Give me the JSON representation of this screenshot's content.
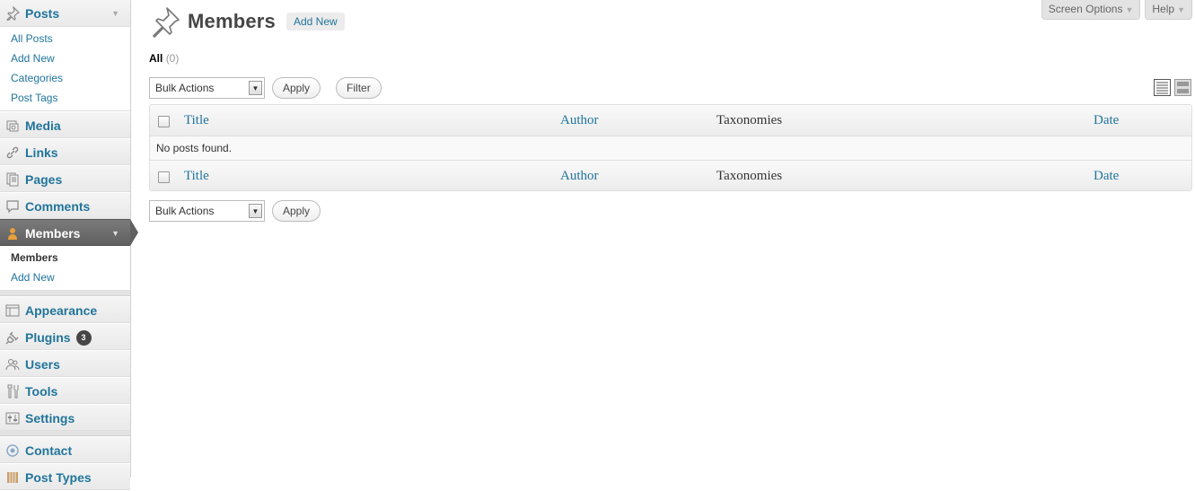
{
  "sidebar": {
    "posts": {
      "label": "Posts",
      "items": [
        "All Posts",
        "Add New",
        "Categories",
        "Post Tags"
      ]
    },
    "media": "Media",
    "links": "Links",
    "pages": "Pages",
    "comments": "Comments",
    "members": {
      "label": "Members",
      "items": [
        "Members",
        "Add New"
      ]
    },
    "appearance": "Appearance",
    "plugins": {
      "label": "Plugins",
      "badge": "3"
    },
    "users": "Users",
    "tools": "Tools",
    "settings": "Settings",
    "contact": "Contact",
    "post_types": "Post Types"
  },
  "screen_meta": {
    "screen_options": "Screen Options",
    "help": "Help"
  },
  "header": {
    "title": "Members",
    "add_new": "Add New"
  },
  "views": {
    "all_label": "All",
    "all_count": "(0)"
  },
  "tablenav_top": {
    "bulk_actions": "Bulk Actions",
    "apply": "Apply",
    "filter": "Filter"
  },
  "tablenav_bottom": {
    "bulk_actions": "Bulk Actions",
    "apply": "Apply"
  },
  "table": {
    "columns": [
      "Title",
      "Author",
      "Taxonomies",
      "Date"
    ],
    "empty_message": "No posts found."
  },
  "colors": {
    "link": "#21759b",
    "current_menu": "#606060",
    "badge": "#464646"
  }
}
